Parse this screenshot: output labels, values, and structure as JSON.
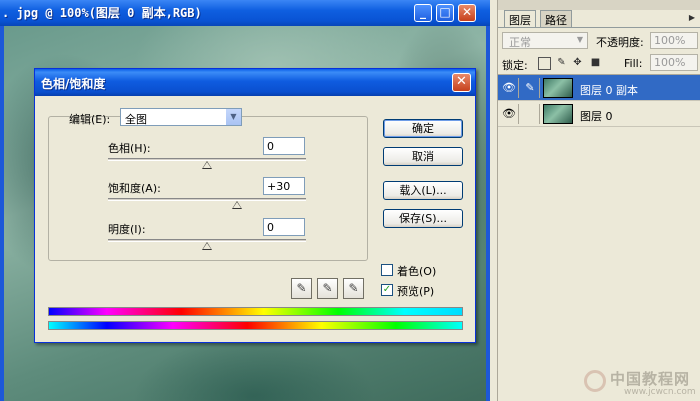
{
  "document": {
    "title": ". jpg @ 100%(图层 0 副本,RGB)"
  },
  "dialog": {
    "title": "色相/饱和度",
    "edit_label": "编辑(E):",
    "edit_value": "全图",
    "hue_label": "色相(H):",
    "hue_value": "0",
    "hue_level": 0,
    "saturation_label": "饱和度(A):",
    "saturation_value": "+30",
    "saturation_level": 30,
    "lightness_label": "明度(I):",
    "lightness_value": "0",
    "lightness_level": 0,
    "buttons": {
      "ok": "确定",
      "cancel": "取消",
      "load": "载入(L)...",
      "save": "保存(S)..."
    },
    "colorize_label": "着色(O)",
    "colorize_checked": false,
    "preview_label": "预览(P)",
    "preview_checked": true
  },
  "layers_panel": {
    "tabs": [
      "图层",
      "路径"
    ],
    "blend_mode": "正常",
    "opacity_label": "不透明度:",
    "opacity_value": "100%",
    "lock_label": "锁定:",
    "fill_label": "Fill:",
    "fill_value": "100%",
    "layers": [
      {
        "name": "图层 0 副本",
        "selected": true
      },
      {
        "name": "图层 0",
        "selected": false
      }
    ]
  },
  "watermark": {
    "text": "中国教程网",
    "url": "www.jcwcn.com"
  }
}
